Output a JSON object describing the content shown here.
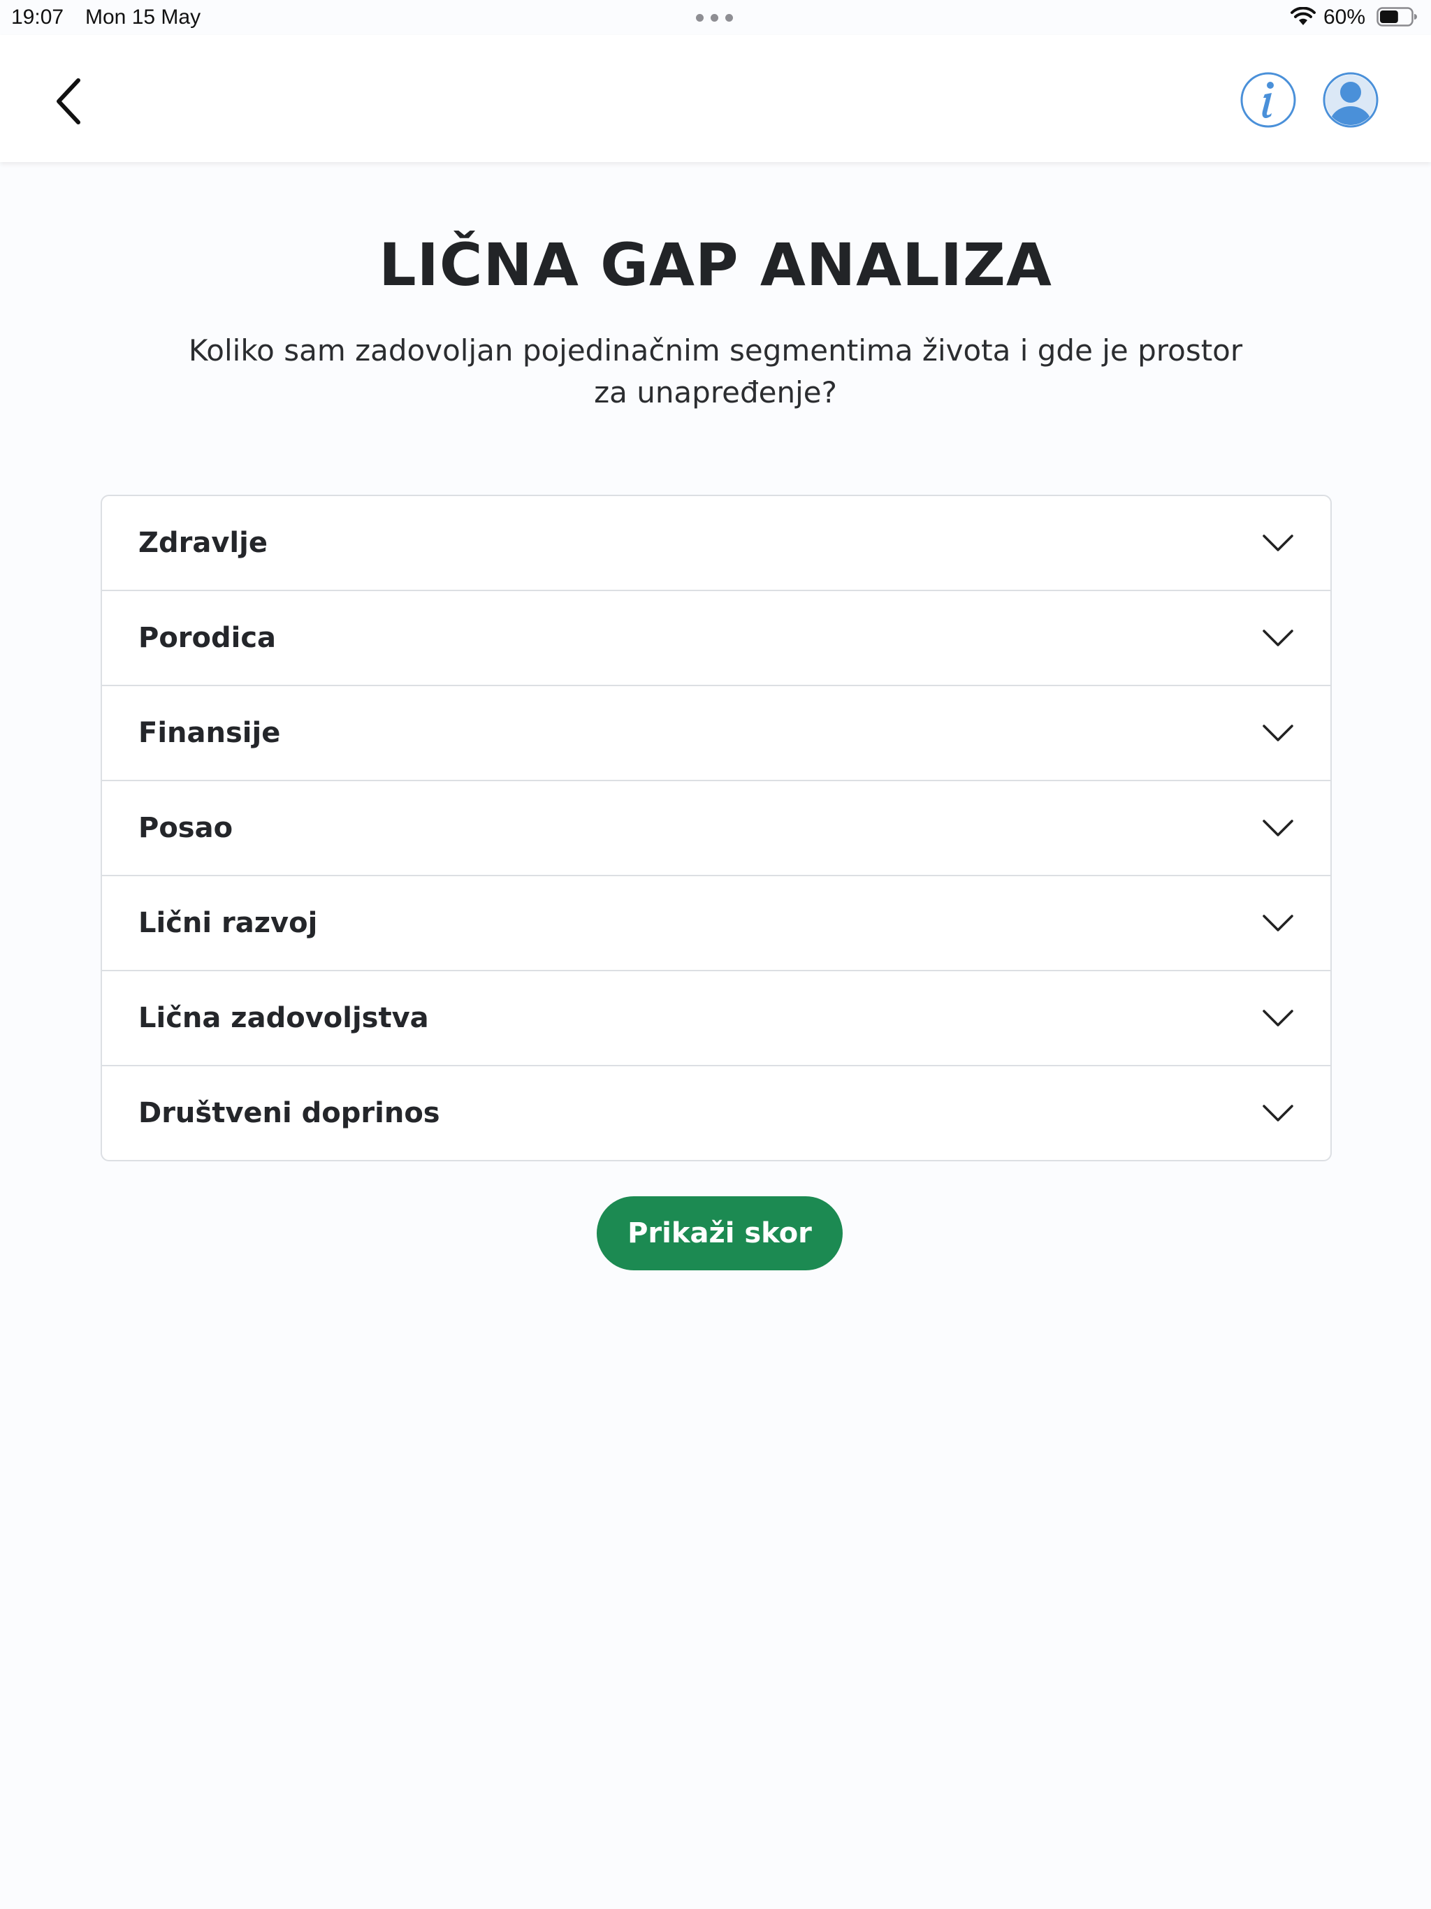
{
  "status_bar": {
    "time": "19:07",
    "date": "Mon 15 May",
    "battery_percent": "60%",
    "battery_level": 0.6
  },
  "header": {
    "back_icon": "chevron-left-icon",
    "info_icon": "info-icon",
    "profile_icon": "user-avatar-icon",
    "icon_color": "#4a90d9"
  },
  "main": {
    "title": "LIČNA GAP ANALIZA",
    "subtitle": "Koliko sam zadovoljan pojedinačnim segmentima života i gde je prostor za unapređenje?"
  },
  "accordion": {
    "items": [
      {
        "label": "Zdravlje"
      },
      {
        "label": "Porodica"
      },
      {
        "label": "Finansije"
      },
      {
        "label": "Posao"
      },
      {
        "label": "Lični razvoj"
      },
      {
        "label": "Lična zadovoljstva"
      },
      {
        "label": "Društveni doprinos"
      }
    ]
  },
  "actions": {
    "show_score_label": "Prikaži skor",
    "accent_color": "#1c8a52"
  }
}
